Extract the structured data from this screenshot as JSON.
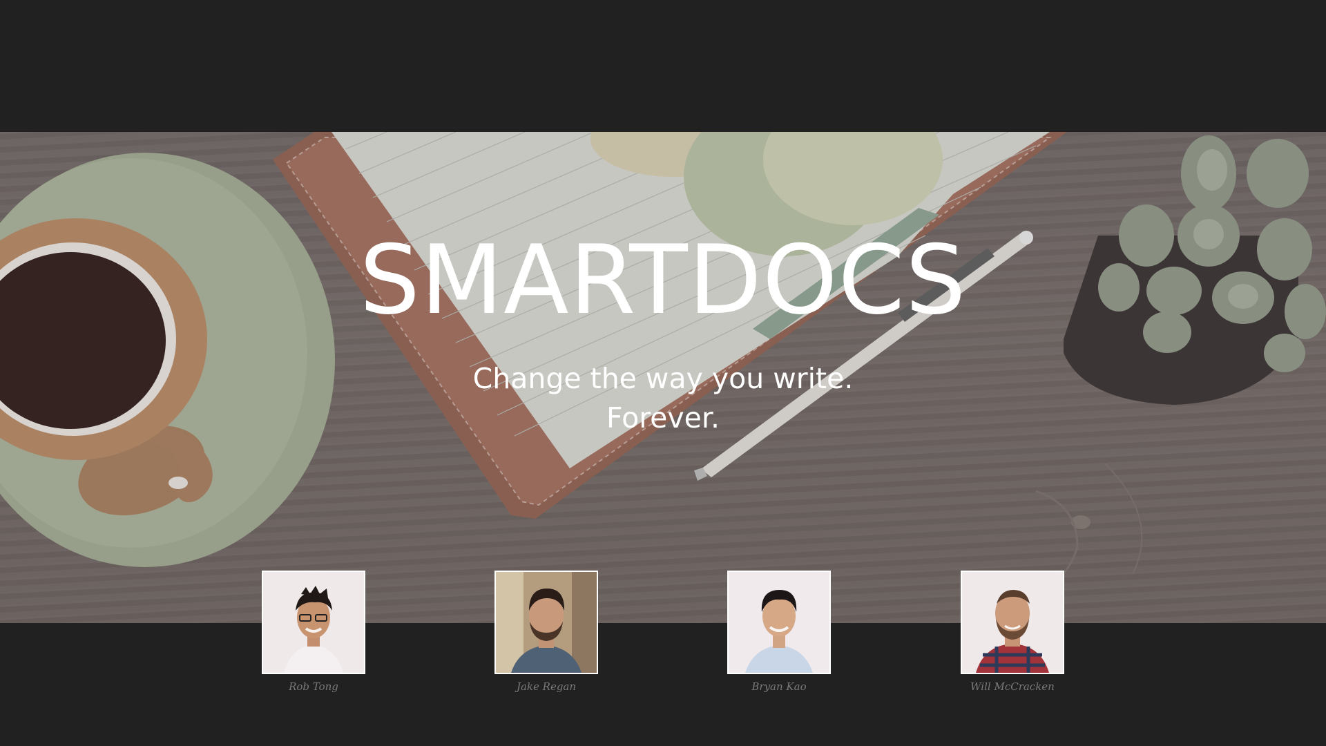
{
  "title": "SMARTDOCS",
  "tagline_line1": "Change the way you write.",
  "tagline_line2": "Forever.",
  "team": [
    {
      "name": "Rob Tong"
    },
    {
      "name": "Jake Regan"
    },
    {
      "name": "Bryan Kao"
    },
    {
      "name": "Will McCracken"
    }
  ],
  "colors": {
    "background": "#212121",
    "title_text": "#ffffff",
    "caption_text": "#7a7a7a"
  }
}
